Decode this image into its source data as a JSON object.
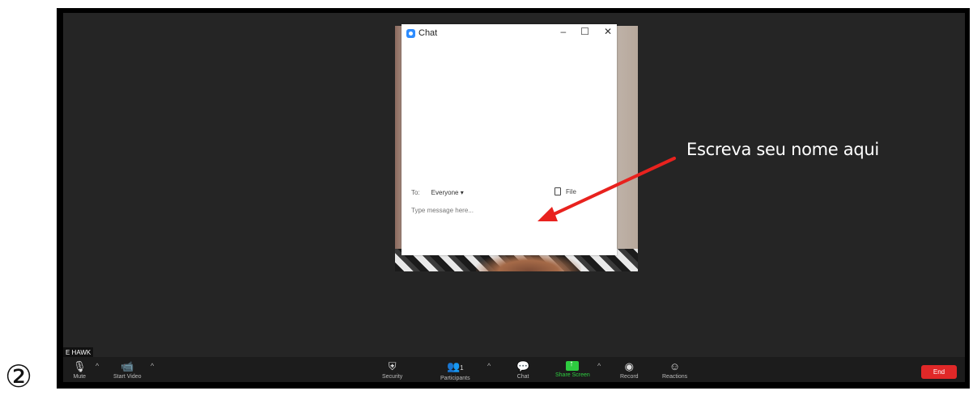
{
  "step_number": "②",
  "annotation": {
    "text": "Escreva seu nome aqui",
    "arrow_color": "#e8221e"
  },
  "chat_window": {
    "title": "Chat",
    "minimize": "–",
    "maximize": "☐",
    "close": "✕",
    "to_label": "To:",
    "recipient": "Everyone ▾",
    "file_label": "File",
    "message_placeholder": "Type message here..."
  },
  "participant_name_tag": "E HAWK",
  "toolbar": {
    "mute_label": "Mute",
    "start_video_label": "Start Video",
    "security_label": "Security",
    "participants_label": "Participants",
    "participants_count": "1",
    "chat_label": "Chat",
    "share_screen_label": "Share Screen",
    "record_label": "Record",
    "reactions_label": "Reactions",
    "end_label": "End",
    "caret": "^"
  },
  "colors": {
    "meeting_bg": "#252525",
    "toolbar_bg": "#1c1c1c",
    "share_green": "#2ecc40",
    "end_red": "#e02828"
  }
}
